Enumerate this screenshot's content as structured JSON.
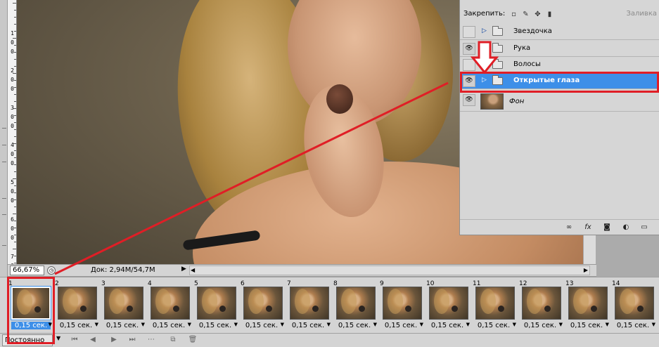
{
  "layers_panel": {
    "lock_label": "Закрепить:",
    "fill_label": "Заливка",
    "layers": [
      {
        "name": "Звездочка",
        "visible": false,
        "selected": false,
        "type": "group"
      },
      {
        "name": "Рука",
        "visible": true,
        "selected": false,
        "type": "group"
      },
      {
        "name": "Волосы",
        "visible": false,
        "selected": false,
        "type": "group"
      },
      {
        "name": "Открытые глаза",
        "visible": true,
        "selected": true,
        "type": "group"
      },
      {
        "name": "Фон",
        "visible": true,
        "selected": false,
        "type": "image"
      }
    ],
    "footer_icons": [
      "link-icon",
      "fx-icon",
      "mask-icon",
      "adjustment-icon",
      "new-group-icon"
    ]
  },
  "ruler": {
    "labels": [
      "1",
      "0",
      "0",
      "2",
      "0",
      "0",
      "3",
      "0",
      "0",
      "4",
      "0",
      "0",
      "5",
      "0",
      "0",
      "6",
      "0",
      "0",
      "7",
      "0",
      "0"
    ]
  },
  "status_bar": {
    "zoom": "66,67%",
    "doc_info": "Док: 2,94M/54,7M"
  },
  "frames": {
    "selected": 1,
    "items": [
      {
        "number": "1",
        "delay": "0,15 сек."
      },
      {
        "number": "2",
        "delay": "0,15 сек."
      },
      {
        "number": "3",
        "delay": "0,15 сек."
      },
      {
        "number": "4",
        "delay": "0,15 сек."
      },
      {
        "number": "5",
        "delay": "0,15 сек."
      },
      {
        "number": "6",
        "delay": "0,15 сек."
      },
      {
        "number": "7",
        "delay": "0,15 сек."
      },
      {
        "number": "8",
        "delay": "0,15 сек."
      },
      {
        "number": "9",
        "delay": "0,15 сек."
      },
      {
        "number": "10",
        "delay": "0,15 сек."
      },
      {
        "number": "11",
        "delay": "0,15 сек."
      },
      {
        "number": "12",
        "delay": "0,15 сек."
      },
      {
        "number": "13",
        "delay": "0,15 сек."
      },
      {
        "number": "14",
        "delay": "0,15 сек."
      }
    ]
  },
  "animation_toolbar": {
    "loop_value": "Постоянно"
  },
  "colors": {
    "selection_blue": "#3d8fe8",
    "annotation_red": "#e01e26",
    "panel_gray": "#d6d6d6"
  }
}
